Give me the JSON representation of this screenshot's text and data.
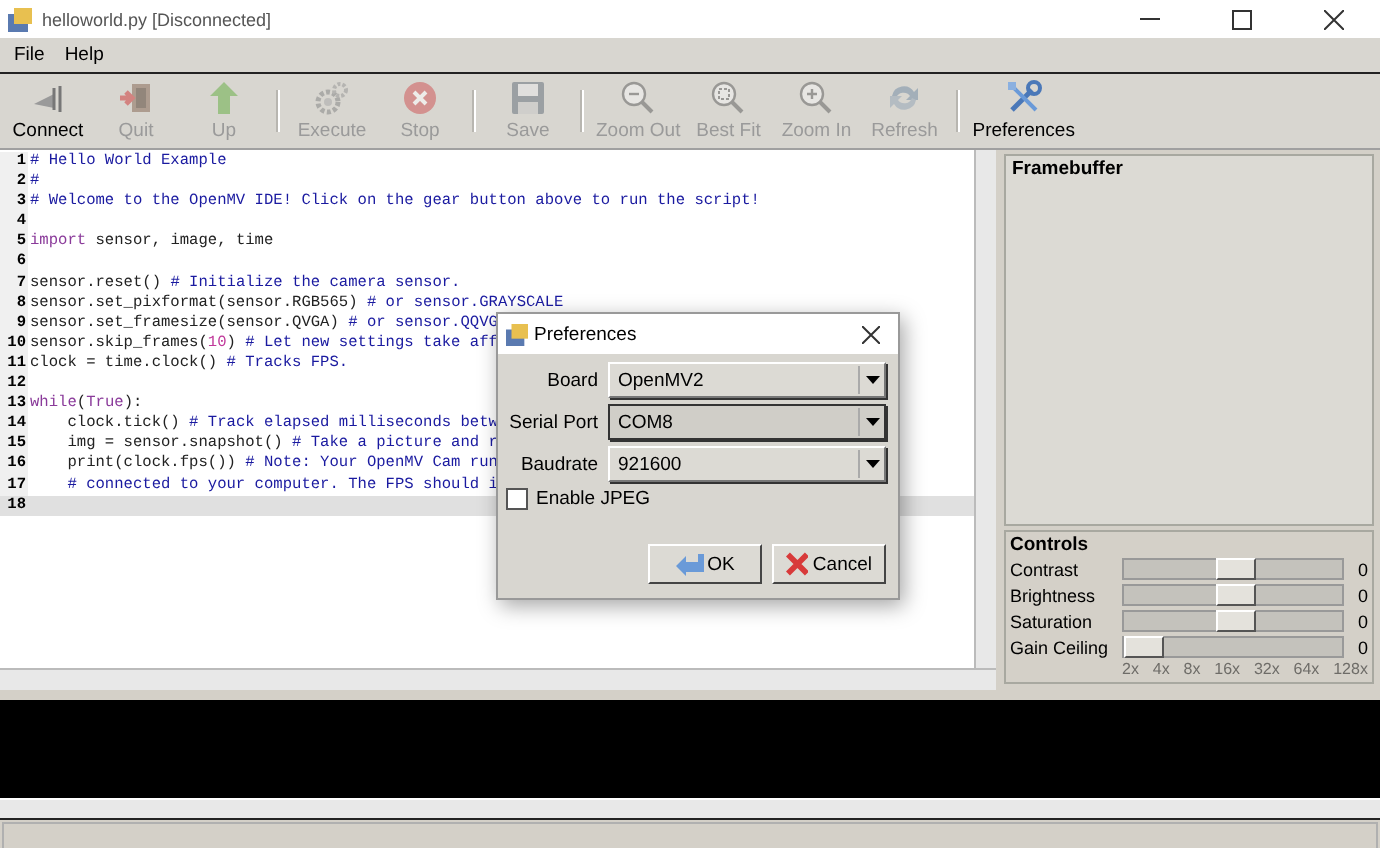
{
  "window": {
    "title": "helloworld.py [Disconnected]"
  },
  "menu": [
    {
      "label": "File"
    },
    {
      "label": "Help"
    }
  ],
  "toolbar": {
    "groups": [
      [
        {
          "label": "Connect",
          "kind": "connect",
          "disabled": false
        },
        {
          "label": "Quit",
          "kind": "quit",
          "disabled": true
        },
        {
          "label": "Up",
          "kind": "up",
          "disabled": true
        }
      ],
      [
        {
          "label": "Execute",
          "kind": "execute",
          "disabled": true
        },
        {
          "label": "Stop",
          "kind": "stop",
          "disabled": true
        }
      ],
      [
        {
          "label": "Save",
          "kind": "save",
          "disabled": true
        }
      ],
      [
        {
          "label": "Zoom Out",
          "kind": "zoomout",
          "disabled": true
        },
        {
          "label": "Best Fit",
          "kind": "zoomfit",
          "disabled": true
        },
        {
          "label": "Zoom In",
          "kind": "zoomin",
          "disabled": true
        },
        {
          "label": "Refresh",
          "kind": "refresh",
          "disabled": true
        }
      ],
      [
        {
          "label": "Preferences",
          "kind": "preferences",
          "disabled": false
        }
      ]
    ]
  },
  "editor": {
    "lines": [
      {
        "number": "1",
        "current": false,
        "segments": [
          {
            "kind": "comment",
            "text": "# Hello World Example"
          }
        ]
      },
      {
        "number": "2",
        "current": false,
        "segments": [
          {
            "kind": "comment",
            "text": "#"
          }
        ]
      },
      {
        "number": "3",
        "current": false,
        "segments": [
          {
            "kind": "comment",
            "text": "# Welcome to the OpenMV IDE! Click on the gear button above to run the script!"
          }
        ]
      },
      {
        "number": "4",
        "current": false
      },
      {
        "number": "5",
        "current": false,
        "segments": [
          {
            "kind": "keyword",
            "text": "import"
          },
          {
            "kind": "plain",
            "text": " sensor, image, time"
          }
        ]
      },
      {
        "number": "6",
        "current": false
      },
      {
        "number": "7",
        "current": false,
        "segments": [
          {
            "kind": "plain",
            "text": "sensor.reset() "
          },
          {
            "kind": "comment",
            "text": "# Initialize the camera sensor."
          }
        ]
      },
      {
        "number": "8",
        "current": false,
        "segments": [
          {
            "kind": "plain",
            "text": "sensor.set_pixformat(sensor.RGB565) "
          },
          {
            "kind": "comment",
            "text": "# or sensor.GRAYSCALE"
          }
        ]
      },
      {
        "number": "9",
        "current": false,
        "segments": [
          {
            "kind": "plain",
            "text": "sensor.set_framesize(sensor.QVGA) "
          },
          {
            "kind": "comment",
            "text": "# or sensor.QQVG"
          }
        ]
      },
      {
        "number": "10",
        "current": false,
        "segments": [
          {
            "kind": "plain",
            "text": "sensor.skip_frames("
          },
          {
            "kind": "number",
            "text": "10"
          },
          {
            "kind": "plain",
            "text": ") "
          },
          {
            "kind": "comment",
            "text": "# Let new settings take aff"
          }
        ]
      },
      {
        "number": "11",
        "current": false,
        "segments": [
          {
            "kind": "plain",
            "text": "clock = time.clock() "
          },
          {
            "kind": "comment",
            "text": "# Tracks FPS."
          }
        ]
      },
      {
        "number": "12",
        "current": false
      },
      {
        "number": "13",
        "current": false,
        "segments": [
          {
            "kind": "keyword",
            "text": "while"
          },
          {
            "kind": "plain",
            "text": "("
          },
          {
            "kind": "keyword",
            "text": "True"
          },
          {
            "kind": "plain",
            "text": "):"
          }
        ]
      },
      {
        "number": "14",
        "current": false,
        "segments": [
          {
            "kind": "plain",
            "text": "    clock.tick() "
          },
          {
            "kind": "comment",
            "text": "# Track elapsed milliseconds betw"
          }
        ]
      },
      {
        "number": "15",
        "current": false,
        "segments": [
          {
            "kind": "plain",
            "text": "    img = sensor.snapshot() "
          },
          {
            "kind": "comment",
            "text": "# Take a picture and r"
          }
        ]
      },
      {
        "number": "16",
        "current": false,
        "segments": [
          {
            "kind": "plain",
            "text": "    print(clock.fps()) "
          },
          {
            "kind": "comment",
            "text": "# Note: Your OpenMV Cam run"
          }
        ]
      },
      {
        "number": "17",
        "current": false,
        "segments": [
          {
            "kind": "comment",
            "text": "    # connected to your computer. The FPS should i"
          }
        ]
      },
      {
        "number": "18",
        "current": true
      }
    ]
  },
  "framebuffer": {
    "title": "Framebuffer"
  },
  "controls": {
    "title": "Controls",
    "sliders": [
      {
        "label": "Contrast",
        "level": 0.5,
        "reading": "0"
      },
      {
        "label": "Brightness",
        "level": 0.5,
        "reading": "0"
      },
      {
        "label": "Saturation",
        "level": 0.5,
        "reading": "0"
      },
      {
        "label": "Gain Ceiling",
        "level": 0,
        "reading": "0",
        "ticks": [
          "2x",
          "4x",
          "8x",
          "16x",
          "32x",
          "64x",
          "128x"
        ]
      }
    ]
  },
  "dialog": {
    "title": "Preferences",
    "fields": [
      {
        "label": "Board",
        "value": "OpenMV2",
        "focused": false
      },
      {
        "label": "Serial Port",
        "value": "COM8",
        "focused": true
      },
      {
        "label": "Baudrate",
        "value": "921600",
        "focused": false
      }
    ],
    "checkbox": {
      "label": "Enable JPEG",
      "checked": false
    },
    "buttons": [
      {
        "label": "OK",
        "kind": "ok"
      },
      {
        "label": "Cancel",
        "kind": "cancel"
      }
    ]
  }
}
